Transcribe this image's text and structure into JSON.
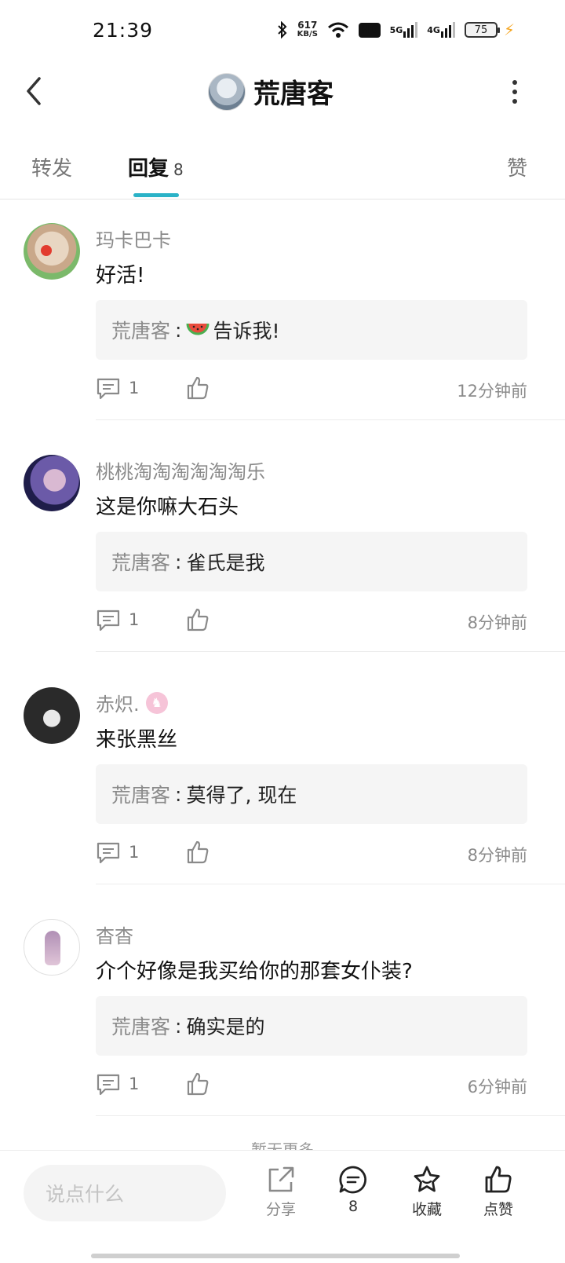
{
  "status_bar": {
    "time": "21:39",
    "net_speed_value": "617",
    "net_speed_unit": "KB/S",
    "hd_label": "HD",
    "signal_5g": "5G",
    "signal_4g": "4G",
    "battery": "75",
    "icons": [
      "bluetooth-icon",
      "wifi-icon",
      "signal-icon",
      "battery-icon",
      "charging-icon"
    ]
  },
  "header": {
    "title": "荒唐客",
    "icons": [
      "back-icon",
      "more-icon"
    ]
  },
  "tabs": {
    "forward": "转发",
    "reply": "回复",
    "reply_count": "8",
    "like": "赞"
  },
  "comments": [
    {
      "name": "玛卡巴卡",
      "text": "好活!",
      "reply_author": "荒唐客",
      "reply_sep": ":",
      "reply_text": "告诉我!",
      "reply_emoji": "watermelon-icon",
      "reply_count": "1",
      "time": "12分钟前"
    },
    {
      "name": "桃桃淘淘淘淘淘淘乐",
      "text": "这是你嘛大石头",
      "reply_author": "荒唐客",
      "reply_sep": ":",
      "reply_text": "雀氏是我",
      "reply_count": "1",
      "time": "8分钟前"
    },
    {
      "name": "赤炽.",
      "text": "来张黑丝",
      "reply_author": "荒唐客",
      "reply_sep": ":",
      "reply_text": "莫得了, 现在",
      "reply_count": "1",
      "time": "8分钟前"
    },
    {
      "name": "杳杳",
      "text": "介个好像是我买给你的那套女仆装?",
      "reply_author": "荒唐客",
      "reply_sep": ":",
      "reply_text": "确实是的",
      "reply_count": "1",
      "time": "6分钟前"
    }
  ],
  "load_more": "暂无更多",
  "bottom_bar": {
    "input_placeholder": "说点什么",
    "share": "分享",
    "comment_count": "8",
    "favorite": "收藏",
    "like": "点赞"
  },
  "colors": {
    "accent": "#2ab2c7",
    "muted_text": "#8a8a8a",
    "reply_bg": "#f5f5f5"
  }
}
